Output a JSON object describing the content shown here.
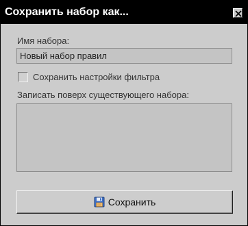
{
  "window": {
    "title": "Сохранить набор как...",
    "close_icon": "close-icon"
  },
  "form": {
    "set_name_label": "Имя набора:",
    "set_name_value": "Новый набор правил",
    "save_filter_label": "Сохранить настройки фильтра",
    "save_filter_checked": false,
    "overwrite_label": "Записать поверх существующего набора:",
    "existing_sets": []
  },
  "actions": {
    "save_label": "Сохранить",
    "save_icon": "floppy-disk-icon"
  }
}
